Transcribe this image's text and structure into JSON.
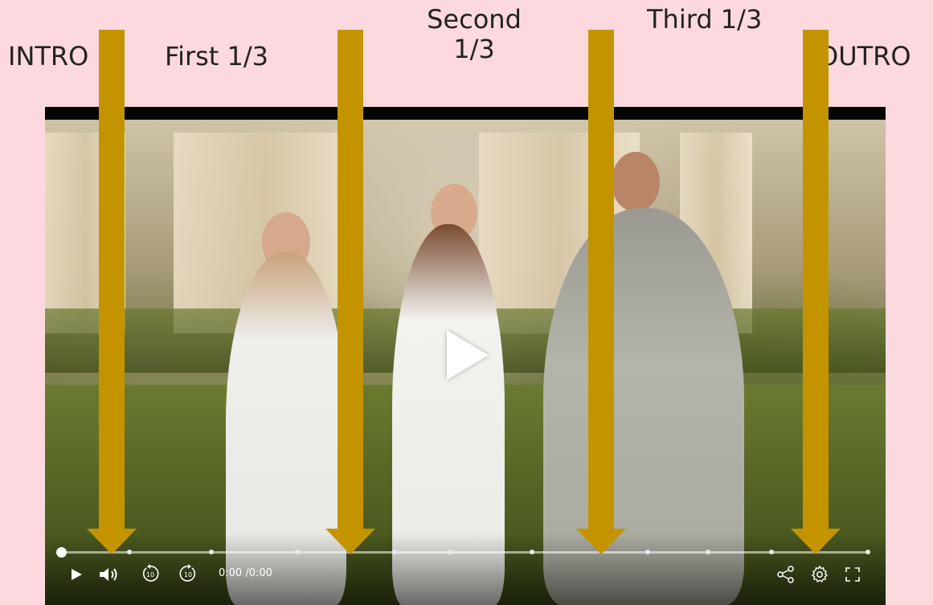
{
  "labels": {
    "intro": "INTRO",
    "first": "First 1/3",
    "second_line1": "Second",
    "second_line2": "1/3",
    "third": "Third 1/3",
    "outro": "OUTRO"
  },
  "player": {
    "time_display": "0:00 /0:00",
    "play_state": "paused",
    "progress_fraction": 0,
    "controls": {
      "play": "play-icon",
      "volume": "volume-icon",
      "rewind": "rewind-10-icon",
      "forward": "forward-10-icon",
      "share": "share-icon",
      "settings": "gear-icon",
      "fullscreen": "fullscreen-icon"
    },
    "skip_seconds": "10"
  },
  "colors": {
    "background": "#fcd9df",
    "arrow": "#c49400"
  }
}
